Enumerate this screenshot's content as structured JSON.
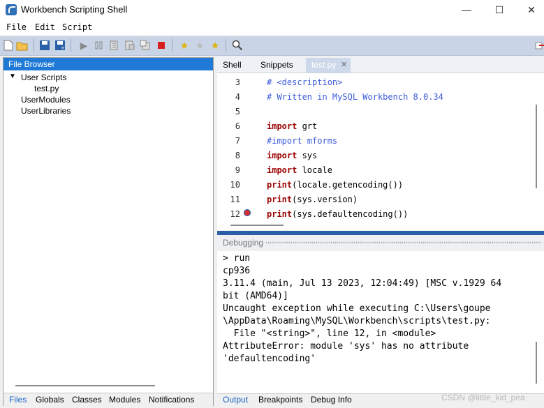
{
  "window": {
    "title": "Workbench Scripting Shell",
    "minimize": "—",
    "maximize": "☐",
    "close": "✕"
  },
  "menu": [
    "File",
    "Edit",
    "Script"
  ],
  "file_browser": {
    "title": "File Browser",
    "tree": [
      {
        "label": "User Scripts",
        "expanded": true,
        "children": [
          "test.py"
        ]
      },
      {
        "label": "UserModules"
      },
      {
        "label": "UserLibraries"
      }
    ],
    "tabs": [
      "Files",
      "Globals",
      "Classes",
      "Modules",
      "Notifications"
    ]
  },
  "editor": {
    "tabs": [
      "Shell",
      "Snippets",
      "test.py"
    ],
    "active_tab": "test.py",
    "lines": [
      {
        "n": "3",
        "text": "# <description>"
      },
      {
        "n": "4",
        "text": "# Written in MySQL Workbench 8.0.34"
      },
      {
        "n": "5",
        "text": ""
      },
      {
        "n": "6",
        "kw": "import",
        "text": " grt"
      },
      {
        "n": "7",
        "text": "#import mforms"
      },
      {
        "n": "8",
        "kw": "import",
        "text": " sys"
      },
      {
        "n": "9",
        "kw": "import",
        "text": " locale"
      },
      {
        "n": "10",
        "kw": "print",
        "text": "(locale.getencoding())"
      },
      {
        "n": "11",
        "kw": "print",
        "text": "(sys.version)"
      },
      {
        "n": "12",
        "kw": "print",
        "text": "(sys.defaultencoding())"
      }
    ]
  },
  "debugging": {
    "title": "Debugging",
    "output": [
      "> run",
      "cp936",
      "3.11.4 (main, Jul 13 2023, 12:04:49) [MSC v.1929 64",
      "bit (AMD64)]",
      "Uncaught exception while executing C:\\Users\\goupe",
      "\\AppData\\Roaming\\MySQL\\Workbench\\scripts\\test.py:",
      "  File \"<string>\", line 12, in <module>",
      "AttributeError: module 'sys' has no attribute",
      "'defaultencoding'"
    ],
    "tabs": [
      "Output",
      "Breakpoints",
      "Debug Info"
    ]
  },
  "watermark": "CSDN @little_kid_pea"
}
